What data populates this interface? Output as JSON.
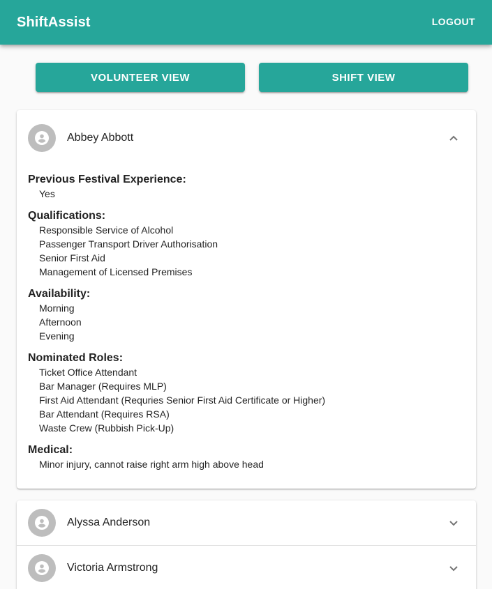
{
  "header": {
    "title": "ShiftAssist",
    "logout_label": "LOGOUT"
  },
  "view_buttons": {
    "volunteer_label": "VOLUNTEER VIEW",
    "shift_label": "SHIFT VIEW"
  },
  "colors": {
    "primary": "#26a69a",
    "avatar_bg": "#bdbdbd",
    "background": "#fafafa"
  },
  "expanded_volunteer": {
    "name": "Abbey Abbott",
    "sections": [
      {
        "title": "Previous Festival Experience:",
        "items": [
          "Yes"
        ]
      },
      {
        "title": "Qualifications:",
        "items": [
          "Responsible Service of Alcohol",
          "Passenger Transport Driver Authorisation",
          "Senior First Aid",
          "Management of Licensed Premises"
        ]
      },
      {
        "title": "Availability:",
        "items": [
          "Morning",
          "Afternoon",
          "Evening"
        ]
      },
      {
        "title": "Nominated Roles:",
        "items": [
          "Ticket Office Attendant",
          "Bar Manager (Requires MLP)",
          "First Aid Attendant (Requries Senior First Aid Certificate or Higher)",
          "Bar Attendant (Requires RSA)",
          "Waste Crew (Rubbish Pick-Up)"
        ]
      },
      {
        "title": "Medical:",
        "items": [
          "Minor injury, cannot raise right arm high above head"
        ]
      }
    ]
  },
  "volunteers": [
    {
      "name": "Alyssa Anderson"
    },
    {
      "name": "Victoria Armstrong"
    }
  ],
  "icons": {
    "avatar": "account-circle-icon",
    "collapse": "chevron-up-icon",
    "expand": "chevron-down-icon"
  }
}
